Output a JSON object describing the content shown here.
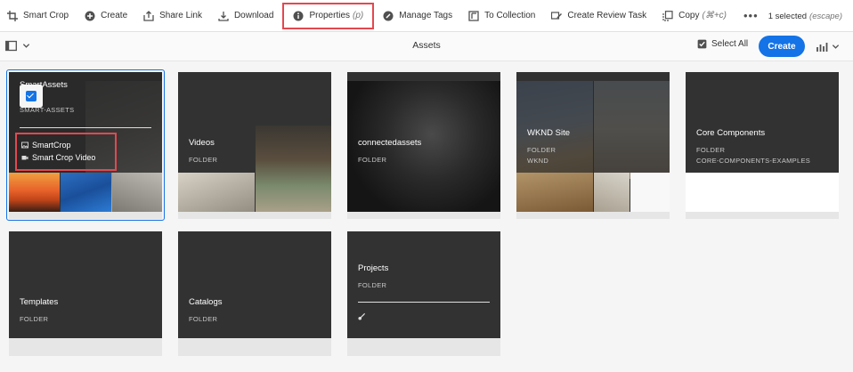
{
  "toolbar": {
    "smart_crop": "Smart Crop",
    "create": "Create",
    "share_link": "Share Link",
    "download": "Download",
    "properties": "Properties",
    "properties_shortcut": "(p)",
    "manage_tags": "Manage Tags",
    "to_collection": "To Collection",
    "create_review_task": "Create Review Task",
    "copy": "Copy",
    "copy_shortcut": "(⌘+c)",
    "more": "•••",
    "selected_count": "1 selected",
    "escape_hint": "(escape)"
  },
  "header": {
    "title": "Assets",
    "select_all": "Select All",
    "create_button": "Create"
  },
  "cards": [
    {
      "name": "SmartAssets",
      "type": "SMART-ASSETS",
      "items": [
        "SmartCrop",
        "Smart Crop Video"
      ],
      "selected": true
    },
    {
      "name": "Videos",
      "type": "FOLDER"
    },
    {
      "name": "connectedassets",
      "type": "FOLDER"
    },
    {
      "name": "WKND Site",
      "type": "FOLDER",
      "sub": "WKND"
    },
    {
      "name": "Core Components",
      "type": "FOLDER",
      "sub": "CORE-COMPONENTS-EXAMPLES"
    },
    {
      "name": "Templates",
      "type": "FOLDER"
    },
    {
      "name": "Catalogs",
      "type": "FOLDER"
    },
    {
      "name": "Projects",
      "type": "FOLDER"
    }
  ],
  "colors": {
    "accent": "#1473e6",
    "highlight": "#e34850",
    "card_bg": "#323232"
  }
}
